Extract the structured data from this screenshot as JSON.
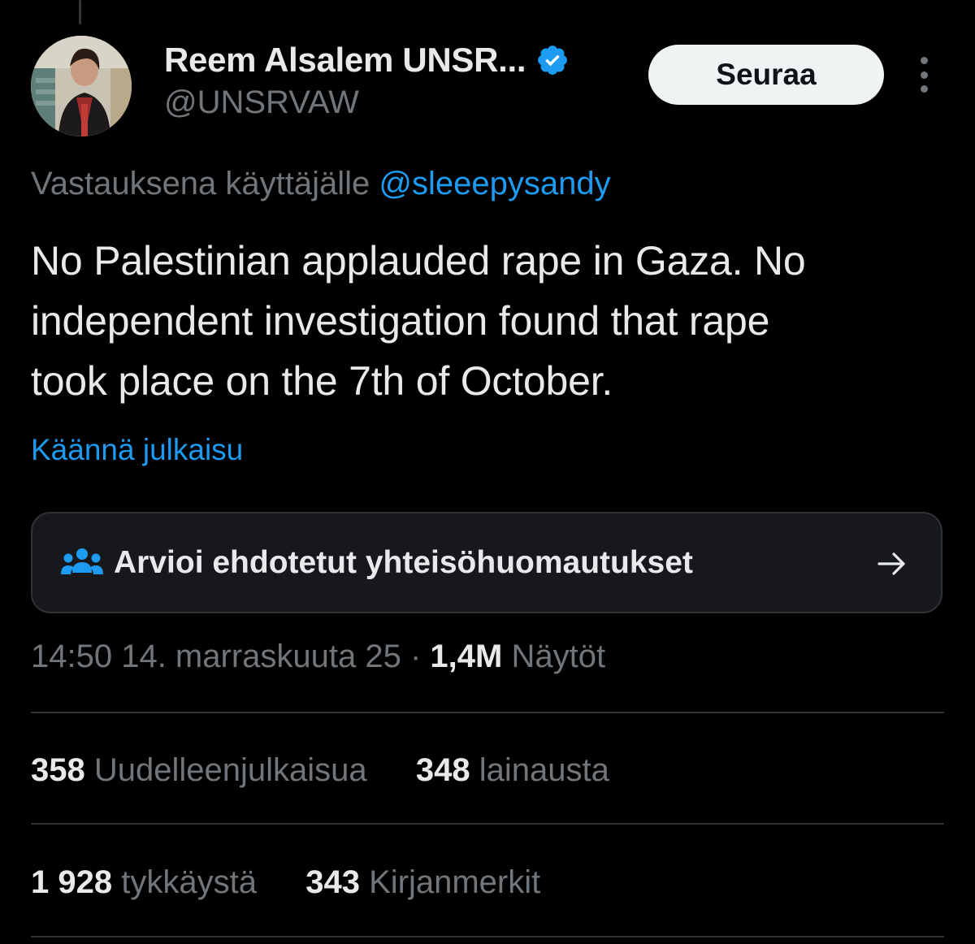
{
  "author": {
    "display_name": "Reem Alsalem UNSR...",
    "handle": "@UNSRVAW",
    "verified_icon": "verified-badge-icon"
  },
  "actions": {
    "follow_label": "Seuraa",
    "more_icon": "more-vertical-icon"
  },
  "reply_context": {
    "prefix": "Vastauksena käyttäjälle",
    "mention": "@sleeepysandy"
  },
  "tweet": {
    "lines": [
      "No Palestinian applauded rape in Gaza. No",
      "independent investigation found that rape",
      "took place on the 7th of October."
    ],
    "translate_label": "Käännä julkaisu"
  },
  "community_notes": {
    "icon": "people-icon",
    "label": "Arvioi ehdotetut yhteisöhuomautukset",
    "arrow": "arrow-right-icon"
  },
  "meta": {
    "timestamp": "14:50 14. marraskuuta 25",
    "separator": "·",
    "views_count": "1,4M",
    "views_label": "Näytöt"
  },
  "stats": {
    "reposts_count": "358",
    "reposts_label": "Uudelleenjulkaisua",
    "quotes_count": "348",
    "quotes_label": "lainausta",
    "likes_count": "1 928",
    "likes_label": "tykkäystä",
    "bookmarks_count": "343",
    "bookmarks_label": "Kirjanmerkit"
  },
  "colors": {
    "background": "#000000",
    "text_primary": "#e7e9ea",
    "text_secondary": "#71767b",
    "accent_blue": "#1d9bf0",
    "divider": "#2f3336",
    "follow_button_bg": "#eff3f4"
  }
}
